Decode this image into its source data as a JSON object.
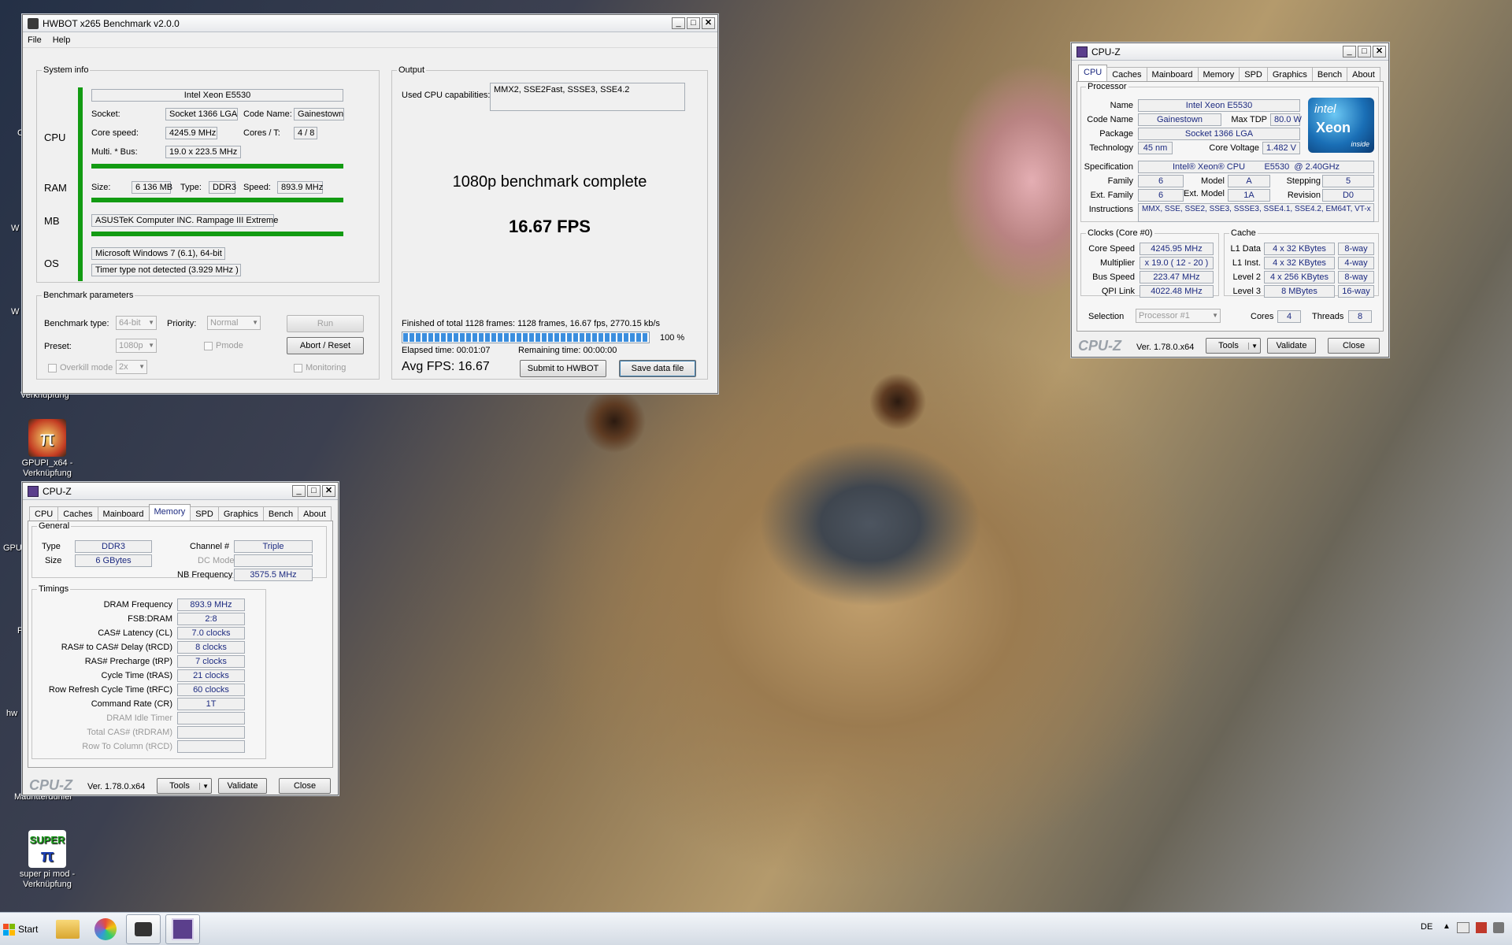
{
  "desktop": {
    "icons": [
      {
        "label": "GPUPI_x64 - Verknüpfung"
      },
      {
        "label": "super pi mod - Verknüpfung"
      }
    ],
    "fragments": [
      "Verknüpfung",
      "Mauritterdunier",
      "W",
      "W",
      "GPU",
      "hw",
      "C",
      "F"
    ]
  },
  "hwbot": {
    "title": "HWBOT x265 Benchmark v2.0.0",
    "menu": [
      "File",
      "Help"
    ],
    "sysinfo": {
      "legend": "System info",
      "cpu_name": "Intel Xeon E5530",
      "sections": {
        "cpu": "CPU",
        "ram": "RAM",
        "mb": "MB",
        "os": "OS"
      },
      "socket_label": "Socket:",
      "socket": "Socket 1366 LGA",
      "codename_label": "Code Name:",
      "codename": "Gainestown",
      "corespeed_label": "Core speed:",
      "corespeed": "4245.9 MHz",
      "cores_label": "Cores / T:",
      "cores": "4 / 8",
      "multi_label": "Multi. * Bus:",
      "multi": "19.0 x 223.5 MHz",
      "size_label": "Size:",
      "size": "6 136 MB",
      "type_label": "Type:",
      "type": "DDR3",
      "speed_label": "Speed:",
      "speed": "893.9 MHz",
      "mb": "ASUSTeK Computer INC. Rampage III Extreme",
      "os": "Microsoft Windows 7 (6.1), 64-bit",
      "timer": "Timer type not detected (3.929 MHz )"
    },
    "params": {
      "legend": "Benchmark parameters",
      "btype_label": "Benchmark type:",
      "btype": "64-bit",
      "priority_label": "Priority:",
      "priority": "Normal",
      "run": "Run",
      "preset_label": "Preset:",
      "preset": "1080p",
      "pmode": "Pmode",
      "abort": "Abort / Reset",
      "overkill": "Overkill mode",
      "overkill_val": "2x",
      "monitoring": "Monitoring"
    },
    "output": {
      "legend": "Output",
      "caps_label": "Used CPU capabilities:",
      "caps": "MMX2, SSE2Fast, SSSE3, SSE4.2",
      "complete": "1080p benchmark complete",
      "fps": "16.67 FPS",
      "finished": "Finished of total 1128 frames: 1128 frames, 16.67 fps,  2770.15 kb/s",
      "progress": 100,
      "progress_label": "100 %",
      "elapsed": "Elapsed time: 00:01:07",
      "remaining": "Remaining time: 00:00:00",
      "avg": "Avg FPS: 16.67",
      "submit": "Submit to HWBOT",
      "save": "Save data file"
    }
  },
  "cpuz_mem": {
    "title": "CPU-Z",
    "tabs": [
      "CPU",
      "Caches",
      "Mainboard",
      "Memory",
      "SPD",
      "Graphics",
      "Bench",
      "About"
    ],
    "active_tab": "Memory",
    "general": {
      "legend": "General",
      "type_label": "Type",
      "type": "DDR3",
      "size_label": "Size",
      "size": "6 GBytes",
      "channel_label": "Channel #",
      "channel": "Triple",
      "dcmode_label": "DC Mode",
      "nbfreq_label": "NB Frequency",
      "nbfreq": "3575.5 MHz"
    },
    "timings": {
      "legend": "Timings",
      "rows": [
        {
          "label": "DRAM Frequency",
          "value": "893.9 MHz"
        },
        {
          "label": "FSB:DRAM",
          "value": "2:8"
        },
        {
          "label": "CAS# Latency (CL)",
          "value": "7.0 clocks"
        },
        {
          "label": "RAS# to CAS# Delay (tRCD)",
          "value": "8 clocks"
        },
        {
          "label": "RAS# Precharge (tRP)",
          "value": "7 clocks"
        },
        {
          "label": "Cycle Time (tRAS)",
          "value": "21 clocks"
        },
        {
          "label": "Row Refresh Cycle Time (tRFC)",
          "value": "60 clocks"
        },
        {
          "label": "Command Rate (CR)",
          "value": "1T"
        },
        {
          "label": "DRAM Idle Timer",
          "value": ""
        },
        {
          "label": "Total CAS# (tRDRAM)",
          "value": ""
        },
        {
          "label": "Row To Column (tRCD)",
          "value": ""
        }
      ]
    },
    "logo": "CPU-Z",
    "version": "Ver. 1.78.0.x64",
    "tools": "Tools",
    "validate": "Validate",
    "close": "Close"
  },
  "cpuz_cpu": {
    "title": "CPU-Z",
    "tabs": [
      "CPU",
      "Caches",
      "Mainboard",
      "Memory",
      "SPD",
      "Graphics",
      "Bench",
      "About"
    ],
    "active_tab": "CPU",
    "processor": {
      "legend": "Processor",
      "name_label": "Name",
      "name": "Intel Xeon E5530",
      "codename_label": "Code Name",
      "codename": "Gainestown",
      "tdp_label": "Max TDP",
      "tdp": "80.0 W",
      "package_label": "Package",
      "package": "Socket 1366 LGA",
      "tech_label": "Technology",
      "tech": "45 nm",
      "voltage_label": "Core Voltage",
      "voltage": "1.482 V",
      "spec_label": "Specification",
      "spec": "Intel® Xeon® CPU        E5530  @ 2.40GHz",
      "family_label": "Family",
      "family": "6",
      "model_label": "Model",
      "model": "A",
      "stepping_label": "Stepping",
      "stepping": "5",
      "extfamily_label": "Ext. Family",
      "extfamily": "6",
      "extmodel_label": "Ext. Model",
      "extmodel": "1A",
      "revision_label": "Revision",
      "revision": "D0",
      "instr_label": "Instructions",
      "instr": "MMX, SSE, SSE2, SSE3, SSSE3, SSE4.1, SSE4.2, EM64T, VT-x",
      "badge_intel": "intel",
      "badge_xeon": "Xeon",
      "badge_inside": "inside"
    },
    "clocks": {
      "legend": "Clocks (Core #0)",
      "corespeed_label": "Core Speed",
      "corespeed": "4245.95 MHz",
      "multi_label": "Multiplier",
      "multi": "x 19.0 ( 12 - 20 )",
      "bus_label": "Bus Speed",
      "bus": "223.47 MHz",
      "qpi_label": "QPI Link",
      "qpi": "4022.48 MHz"
    },
    "cache": {
      "legend": "Cache",
      "rows": [
        {
          "label": "L1 Data",
          "size": "4 x 32 KBytes",
          "way": "8-way"
        },
        {
          "label": "L1 Inst.",
          "size": "4 x 32 KBytes",
          "way": "4-way"
        },
        {
          "label": "Level 2",
          "size": "4 x 256 KBytes",
          "way": "8-way"
        },
        {
          "label": "Level 3",
          "size": "8 MBytes",
          "way": "16-way"
        }
      ]
    },
    "selection_label": "Selection",
    "selection": "Processor #1",
    "cores_label": "Cores",
    "cores": "4",
    "threads_label": "Threads",
    "threads": "8",
    "logo": "CPU-Z",
    "version": "Ver. 1.78.0.x64",
    "tools": "Tools",
    "validate": "Validate",
    "close": "Close"
  },
  "taskbar": {
    "start": "Start",
    "lang": "DE"
  }
}
